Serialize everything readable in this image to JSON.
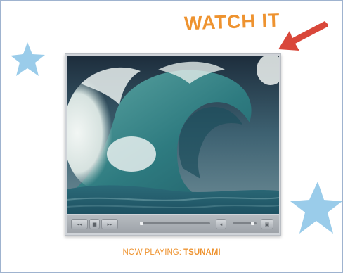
{
  "header": {
    "title": "WATCH IT"
  },
  "player": {
    "now_playing_label": "NOW PLAYING:",
    "now_playing_title": "TSUNAMI"
  },
  "icons": {
    "arrow": "arrow-icon",
    "star_left": "star-icon",
    "star_right": "star-icon",
    "rewind": "rewind-icon",
    "stop": "stop-icon",
    "forward": "fast-forward-icon",
    "volume": "volume-icon",
    "fullscreen": "fullscreen-icon"
  },
  "colors": {
    "accent_orange": "#ee9330",
    "arrow_red": "#d9473a",
    "star_blue": "#8fc6e8"
  }
}
